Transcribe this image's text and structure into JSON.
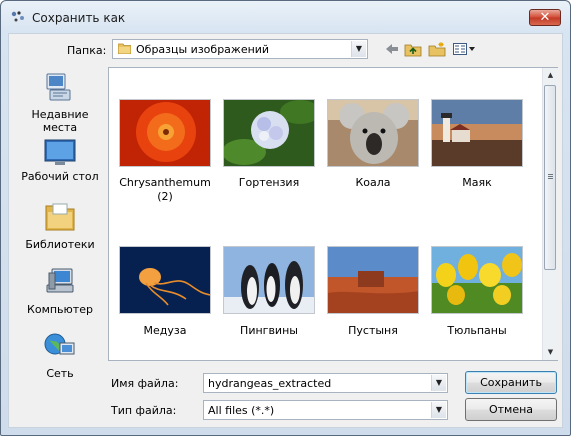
{
  "window": {
    "title": "Сохранить как",
    "close_label": "✕"
  },
  "toolbar": {
    "folder_label": "Папка:",
    "folder_value": "Образцы изображений",
    "icons": [
      "back-arrow-icon",
      "up-folder-icon",
      "new-folder-icon",
      "view-menu-icon"
    ]
  },
  "places": [
    {
      "label": "Недавние места",
      "icon": "recent-places-icon"
    },
    {
      "label": "Рабочий стол",
      "icon": "desktop-icon"
    },
    {
      "label": "Библиотеки",
      "icon": "libraries-icon"
    },
    {
      "label": "Компьютер",
      "icon": "computer-icon"
    },
    {
      "label": "Сеть",
      "icon": "network-icon"
    }
  ],
  "files": [
    {
      "label": "Chrysanthemum\n(2)",
      "icon": "chrysanthemum-thumbnail"
    },
    {
      "label": "Гортензия",
      "icon": "hydrangea-thumbnail"
    },
    {
      "label": "Коала",
      "icon": "koala-thumbnail"
    },
    {
      "label": "Маяк",
      "icon": "lighthouse-thumbnail"
    },
    {
      "label": "Медуза",
      "icon": "jellyfish-thumbnail"
    },
    {
      "label": "Пингвины",
      "icon": "penguins-thumbnail"
    },
    {
      "label": "Пустыня",
      "icon": "desert-thumbnail"
    },
    {
      "label": "Тюльпаны",
      "icon": "tulips-thumbnail"
    }
  ],
  "form": {
    "filename_label": "Имя файла:",
    "filename_value": "hydrangeas_extracted",
    "filetype_label": "Тип файла:",
    "filetype_value": "All files (*.*)"
  },
  "buttons": {
    "save": "Сохранить",
    "cancel": "Отмена"
  }
}
